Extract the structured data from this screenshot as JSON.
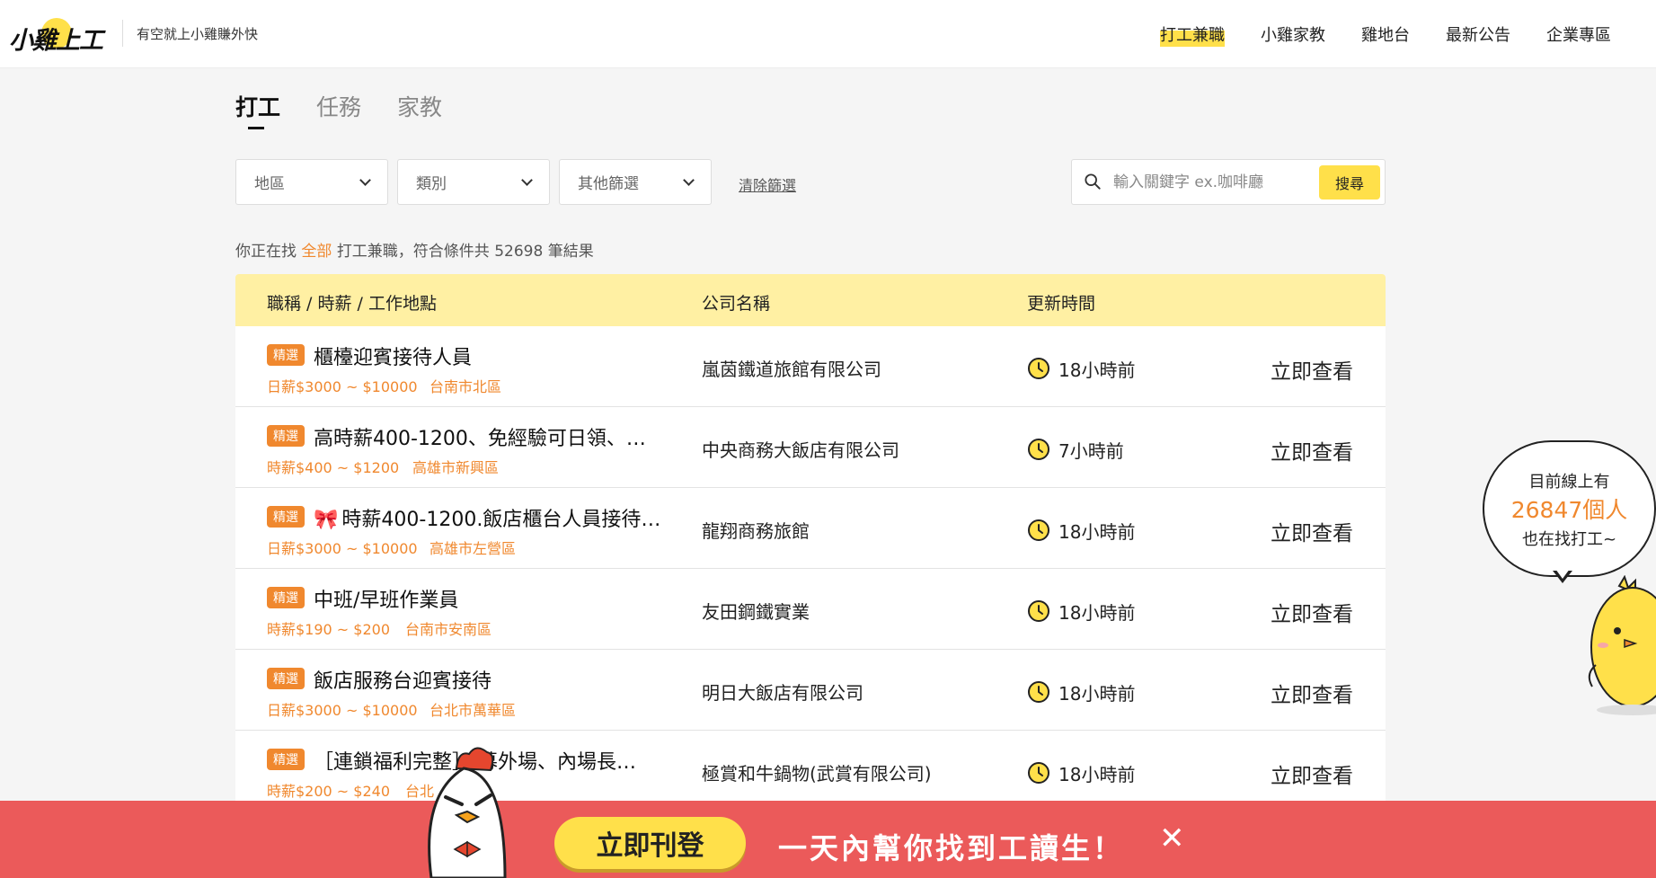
{
  "header": {
    "logo_text": "小雞上工",
    "tagline": "有空就上小雞賺外快",
    "nav": [
      "打工兼職",
      "小雞家教",
      "雞地台",
      "最新公告",
      "企業專區"
    ]
  },
  "tabs": [
    "打工",
    "任務",
    "家教"
  ],
  "filters": {
    "region": "地區",
    "category": "類別",
    "other": "其他篩選",
    "clear": "清除篩選"
  },
  "search": {
    "placeholder": "輸入關鍵字 ex.咖啡廳",
    "button": "搜尋"
  },
  "summary": {
    "prefix": "你正在找",
    "highlight": "全部",
    "suffix": "打工兼職，符合條件共 52698 筆結果"
  },
  "table": {
    "headers": [
      "職稱 / 時薪 / 工作地點",
      "公司名稱",
      "更新時間"
    ],
    "rows": [
      {
        "badge": "精選",
        "title": "櫃檯迎賓接待人員",
        "wage": "日薪$3000 ~ $10000",
        "location": "台南市北區",
        "company": "嵐茵鐵道旅館有限公司",
        "updated": "18小時前",
        "action": "立即查看"
      },
      {
        "badge": "精選",
        "title": "高時薪400-1200、免經驗可日領、…",
        "wage": "時薪$400 ~ $1200",
        "location": "高雄市新興區",
        "company": "中央商務大飯店有限公司",
        "updated": "7小時前",
        "action": "立即查看"
      },
      {
        "badge": "精選",
        "title": "時薪400-1200.飯店櫃台人員接待…",
        "wage": "日薪$3000 ~ $10000",
        "location": "高雄市左營區",
        "company": "龍翔商務旅館",
        "updated": "18小時前",
        "action": "立即查看"
      },
      {
        "badge": "精選",
        "title": "中班/早班作業員",
        "wage": "時薪$190 ~ $200",
        "location": "台南市安南區",
        "company": "友田鋼鐵實業",
        "updated": "18小時前",
        "action": "立即查看"
      },
      {
        "badge": "精選",
        "title": "飯店服務台迎賓接待",
        "wage": "日薪$3000 ~ $10000",
        "location": "台北市萬華區",
        "company": "明日大飯店有限公司",
        "updated": "18小時前",
        "action": "立即查看"
      },
      {
        "badge": "精選",
        "title": "［連鎖福利完整］ 募外場、內場長…",
        "wage": "時薪$200 ~ $240",
        "location": "台北",
        "company": "極賞和牛鍋物(武賞有限公司)",
        "updated": "18小時前",
        "action": "立即查看"
      }
    ]
  },
  "bubble": {
    "line1": "目前線上有",
    "count": "26847個人",
    "line3": "也在找打工~"
  },
  "banner": {
    "button": "立即刊登",
    "text": "一天內幫你找到工讀生！",
    "close": "✕"
  },
  "colors": {
    "accent_yellow": "#ffe04a",
    "accent_orange": "#f0882e",
    "banner_red": "#eb5a5a"
  }
}
